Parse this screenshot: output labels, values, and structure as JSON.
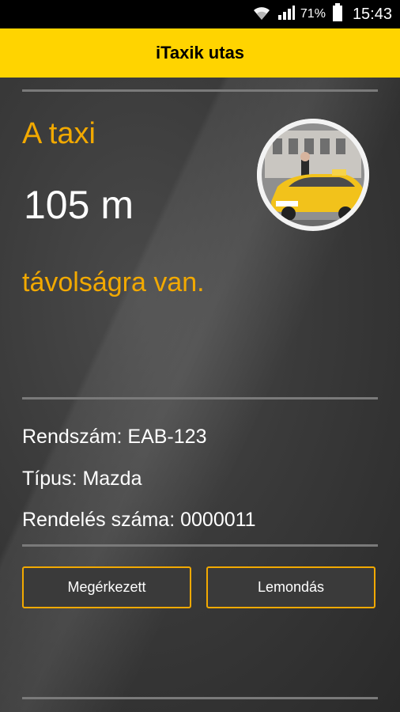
{
  "status_bar": {
    "battery_percent": "71%",
    "time": "15:43",
    "icons": [
      "wifi-icon",
      "signal-icon",
      "battery-icon"
    ]
  },
  "app_bar": {
    "title": "iTaxik utas"
  },
  "taxi": {
    "heading": "A taxi",
    "distance": "105 m",
    "distance_suffix": "távolságra van.",
    "photo": "taxi-photo"
  },
  "details": {
    "plate": {
      "label": "Rendszám:",
      "value": "EAB-123"
    },
    "type": {
      "label": "Típus:",
      "value": "Mazda"
    },
    "order": {
      "label": "Rendelés száma:",
      "value": "0000011"
    }
  },
  "actions": {
    "arrived_label": "Megérkezett",
    "cancel_label": "Lemondás"
  },
  "colors": {
    "accent": "#ffd400",
    "orange_text": "#f2a900",
    "background": "#2f2f2f"
  }
}
